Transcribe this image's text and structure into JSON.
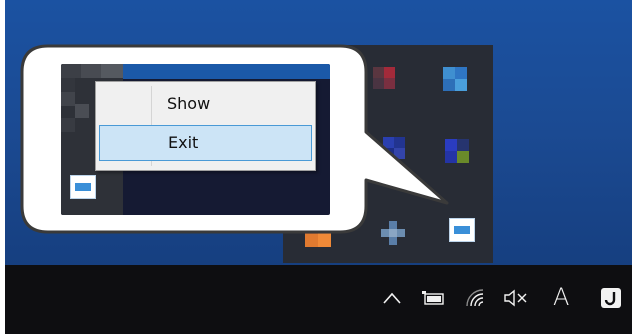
{
  "context_menu": {
    "items": [
      {
        "label": "Show",
        "highlighted": false
      },
      {
        "label": "Exit",
        "highlighted": true
      }
    ]
  },
  "taskbar": {
    "input_indicator": "A",
    "icons": [
      "chevron-up-icon",
      "battery-icon",
      "wifi-icon",
      "speaker-muted-icon",
      "notification-icon"
    ]
  },
  "colors": {
    "wallpaper": "#1b52a2",
    "taskbar": "#0e0e11",
    "flyout": "#282c35",
    "menu_background": "#f0f0f0",
    "menu_highlight": "#cce4f6",
    "menu_highlight_border": "#4a9ad6",
    "bubble_border": "#3a3a3a"
  }
}
